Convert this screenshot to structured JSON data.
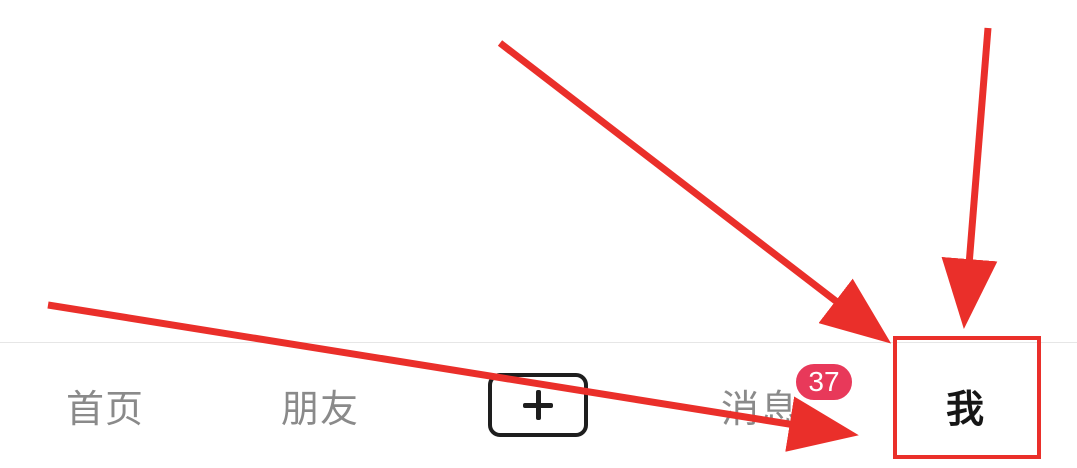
{
  "tab_bar": {
    "tabs": [
      {
        "label": "首页"
      },
      {
        "label": "朋友"
      },
      {
        "label": "消息",
        "badge": "37"
      },
      {
        "label": "我",
        "selected": true
      }
    ]
  },
  "colors": {
    "annotation_red": "#ea2f2a",
    "badge_bg": "#e8395a",
    "active_text": "#161616",
    "inactive_text": "#8a8a8a"
  },
  "icons": {
    "create": "plus-icon"
  }
}
